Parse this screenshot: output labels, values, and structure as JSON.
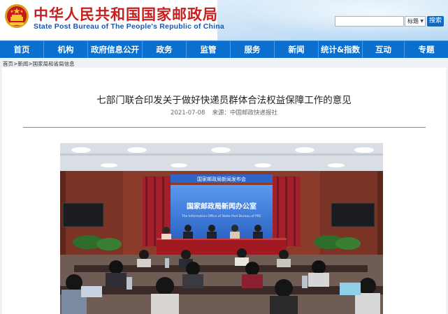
{
  "header": {
    "site_title": "中华人民共和国国家邮政局",
    "site_subtitle": "State Post Bureau of The People's Republic of China",
    "emblem_icon": "national-emblem-icon"
  },
  "search": {
    "value": "",
    "select_value": "标题",
    "button_label": "搜索"
  },
  "nav": {
    "items": [
      {
        "label": "首页"
      },
      {
        "label": "机构"
      },
      {
        "label": "政府信息公开"
      },
      {
        "label": "政务"
      },
      {
        "label": "监管"
      },
      {
        "label": "服务"
      },
      {
        "label": "新闻"
      },
      {
        "label": "统计&指数"
      },
      {
        "label": "互动"
      },
      {
        "label": "专题"
      }
    ]
  },
  "breadcrumb": {
    "items": [
      "首页",
      "新闻",
      "国家局和省局信息"
    ],
    "separator": ">"
  },
  "article": {
    "title": "七部门联合印发关于做好快递员群体合法权益保障工作的意见",
    "date": "2021-07-08",
    "source_label": "来源：",
    "source": "中国邮政快递报社"
  },
  "photo": {
    "screen_title": "国家邮政局新闻办公室",
    "screen_subtitle": "The Information Office of State Post Bureau of PRC",
    "banner_text": "国家邮政局新闻发布会"
  },
  "colors": {
    "nav_blue": "#0b6fd0",
    "title_red": "#c81e1e",
    "subtitle_blue": "#1a57a8"
  }
}
